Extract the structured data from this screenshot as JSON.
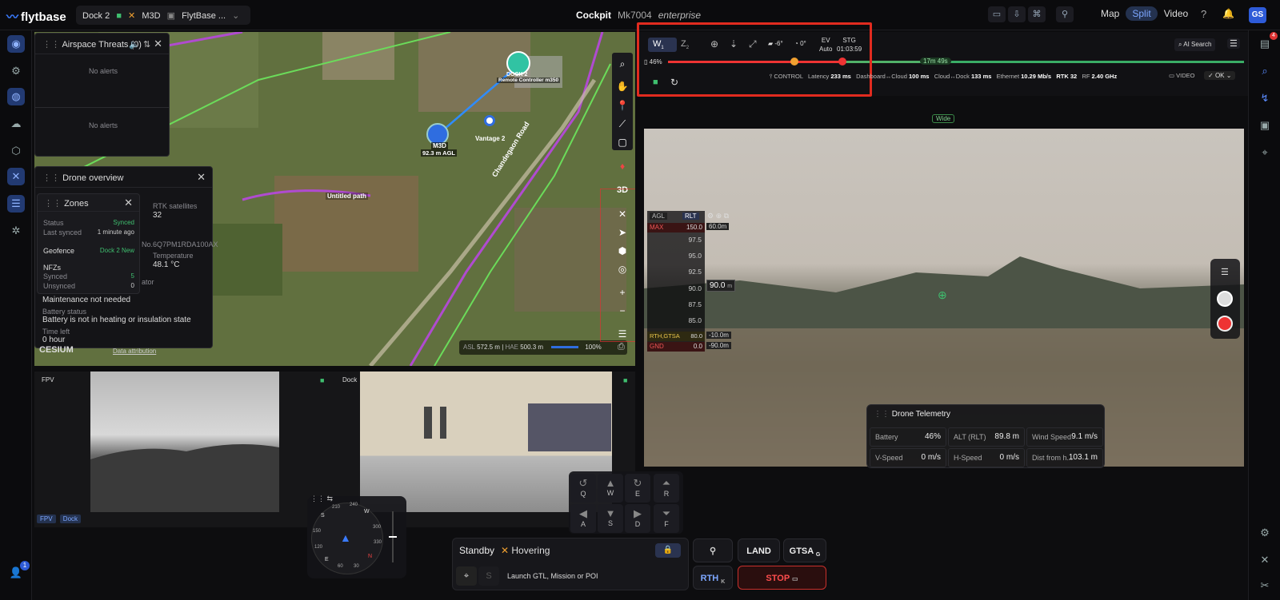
{
  "topbar": {
    "logo": "flytbase",
    "dock": "Dock 2",
    "drone": "M3D",
    "site": "FlytBase ...",
    "title": "Cockpit",
    "model": "Mk7004",
    "edition": "enterprise",
    "view_map": "Map",
    "view_split": "Split",
    "view_video": "Video",
    "avatar": "GS"
  },
  "rightnav": {
    "badge": "4"
  },
  "leftnav": {
    "badge": "1"
  },
  "airspace": {
    "title": "Airspace Threats (0)",
    "empty1": "No alerts",
    "empty2": "No alerts"
  },
  "drone_overview": {
    "title": "Drone overview",
    "rtk_label": "RTK satellites",
    "rtk_value": "32",
    "serial": "No.6Q7PM1RDA100AX",
    "temp_label": "Temperature",
    "temp_value": "48.1 °C",
    "ator": "ator",
    "maint": "Maintenance not needed",
    "batt_label": "Battery status",
    "batt_value": "Battery is not in heating or insulation state",
    "time_label": "Time left",
    "time_value": "0 hour"
  },
  "zones": {
    "title": "Zones",
    "status_label": "Status",
    "status_value": "Synced",
    "last_label": "Last synced",
    "last_value": "1 minute ago",
    "geofence_label": "Geofence",
    "geofence_value": "Dock 2 New",
    "nfz_label": "NFZs",
    "synced_label": "Synced",
    "synced_value": "5",
    "unsynced_label": "Unsynced",
    "unsynced_value": "0"
  },
  "map": {
    "dock_label": "DOCK 2",
    "rc_label": "Remote Controller m350",
    "drone_label": "M3D",
    "drone_agl": "92.3 m AGL",
    "vantage": "Vantage 2",
    "road": "Chandegaon Road",
    "path": "Untitled path",
    "mode_3d": "3D",
    "asl_label": "ASL",
    "asl_value": "572.5 m",
    "hae_label": "HAE",
    "hae_value": "500.3 m",
    "zoom": "100%",
    "cesium": "CESIUM",
    "attribution": "Data attribution"
  },
  "fpv": {
    "label": "FPV"
  },
  "dockcam": {
    "label": "Dock"
  },
  "tabs": {
    "fpv": "FPV",
    "dock": "Dock"
  },
  "compass": {
    "s": "S",
    "w": "W",
    "e": "E",
    "n": "N",
    "t210": "210",
    "t240": "240",
    "t150": "150",
    "t120": "120",
    "t300": "300",
    "t330": "330",
    "t60": "60",
    "t30": "30"
  },
  "hud": {
    "w": "W",
    "w_sub": "1",
    "z": "Z",
    "z_sub": "2",
    "gimbal": "-6°",
    "yaw": "0°",
    "ev_label": "EV",
    "ev_value": "Auto",
    "stg_label": "STG",
    "stg_value": "01:03:59",
    "battery": "46%",
    "flight_time": "17m 49s",
    "control": "CONTROL",
    "latency_label": "Latency",
    "latency_value": "233 ms",
    "dash_label": "Dashboard↔Cloud",
    "dash_value": "100 ms",
    "cloud_label": "Cloud↔Dock",
    "cloud_value": "133 ms",
    "eth_label": "Ethernet",
    "eth_value": "10.29 Mb/s",
    "rtk": "RTK 32",
    "rf_label": "RF",
    "rf_value": "2.40 GHz",
    "video": "VIDEO",
    "ok": "OK",
    "ai_search": "AI Search"
  },
  "video": {
    "wide": "Wide",
    "agl": "AGL",
    "rlt": "RLT",
    "max_label": "MAX",
    "max_value": "150.0",
    "max_diff": "60.0m",
    "t975": "97.5",
    "t95": "95.0",
    "t925": "92.5",
    "t90": "90.0",
    "current": "90.0",
    "unit": "m",
    "t875": "87.5",
    "t85": "85.0",
    "rth_label": "RTH,GTSA",
    "rth_value": "80.0",
    "rth_diff": "-10.0m",
    "gnd_label": "GND",
    "gnd_value": "0.0",
    "gnd_diff": "-90.0m"
  },
  "telemetry": {
    "title": "Drone Telemetry",
    "battery_label": "Battery",
    "battery_value": "46%",
    "alt_label": "ALT (RLT)",
    "alt_value": "89.8 m",
    "wind_label": "Wind Speed",
    "wind_value": "9.1 m/s",
    "vs_label": "V-Speed",
    "vs_value": "0 m/s",
    "hs_label": "H-Speed",
    "hs_value": "0 m/s",
    "dist_label": "Dist from h...",
    "dist_value": "103.1 m"
  },
  "keys": {
    "q": "Q",
    "w": "W",
    "e": "E",
    "r": "R",
    "a": "A",
    "s": "S",
    "d": "D",
    "f": "F"
  },
  "status": {
    "state": "Standby",
    "flight": "Hovering",
    "launch": "Launch GTL, Mission or POI"
  },
  "actions": {
    "land": "LAND",
    "gtsa": "GTSA",
    "gtsa_key": "G",
    "rth": "RTH",
    "rth_key": "K",
    "stop": "STOP"
  }
}
